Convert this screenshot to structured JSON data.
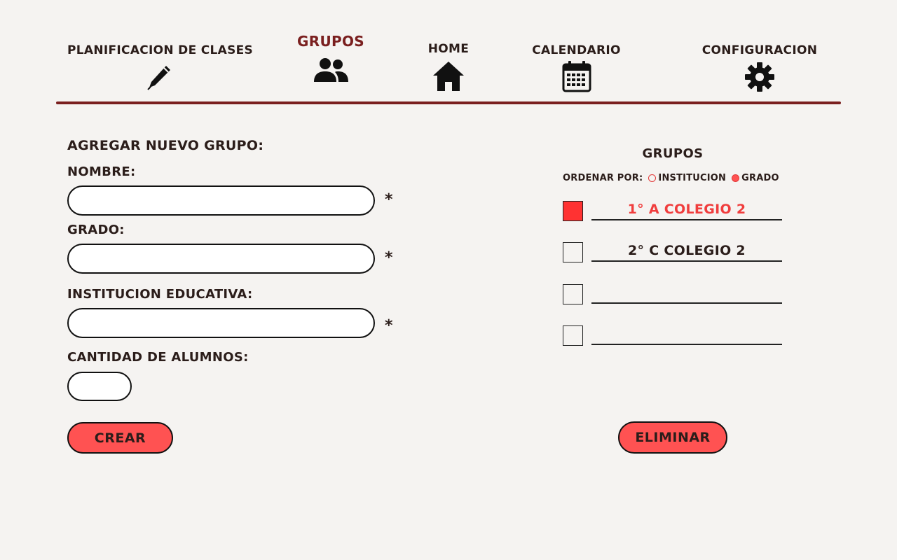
{
  "nav": {
    "items": [
      {
        "label": "PLANIFICACION DE CLASES",
        "icon": "pencil-icon"
      },
      {
        "label": "GRUPOS",
        "icon": "users-icon",
        "active": true
      },
      {
        "label": "HOME",
        "icon": "home-icon"
      },
      {
        "label": "CALENDARIO",
        "icon": "calendar-icon"
      },
      {
        "label": "CONFIGURACION",
        "icon": "gear-icon"
      }
    ]
  },
  "form": {
    "title": "AGREGAR NUEVO GRUPO:",
    "nombre_label": "NOMBRE:",
    "nombre_value": "",
    "grado_label": "GRADO:",
    "grado_value": "",
    "institucion_label": "INSTITUCION EDUCATIVA:",
    "institucion_value": "",
    "cantidad_label": "CANTIDAD DE ALUMNOS:",
    "cantidad_value": "",
    "required_mark": "*",
    "create_button": "CREAR"
  },
  "groups": {
    "title": "GRUPOS",
    "sort_label": "ORDENAR POR:",
    "sort_options": [
      {
        "label": "INSTITUCION",
        "checked": false
      },
      {
        "label": "GRADO",
        "checked": true
      }
    ],
    "items": [
      {
        "name": "1° A COLEGIO 2",
        "checked": true
      },
      {
        "name": "2° C COLEGIO 2",
        "checked": false
      },
      {
        "name": "",
        "checked": false
      },
      {
        "name": "",
        "checked": false
      }
    ],
    "delete_button": "ELIMINAR"
  },
  "colors": {
    "accent_dark_red": "#7a1f1f",
    "button_red": "#ff5252",
    "selected_red": "#f03d3d",
    "background": "#f5f3f1"
  }
}
